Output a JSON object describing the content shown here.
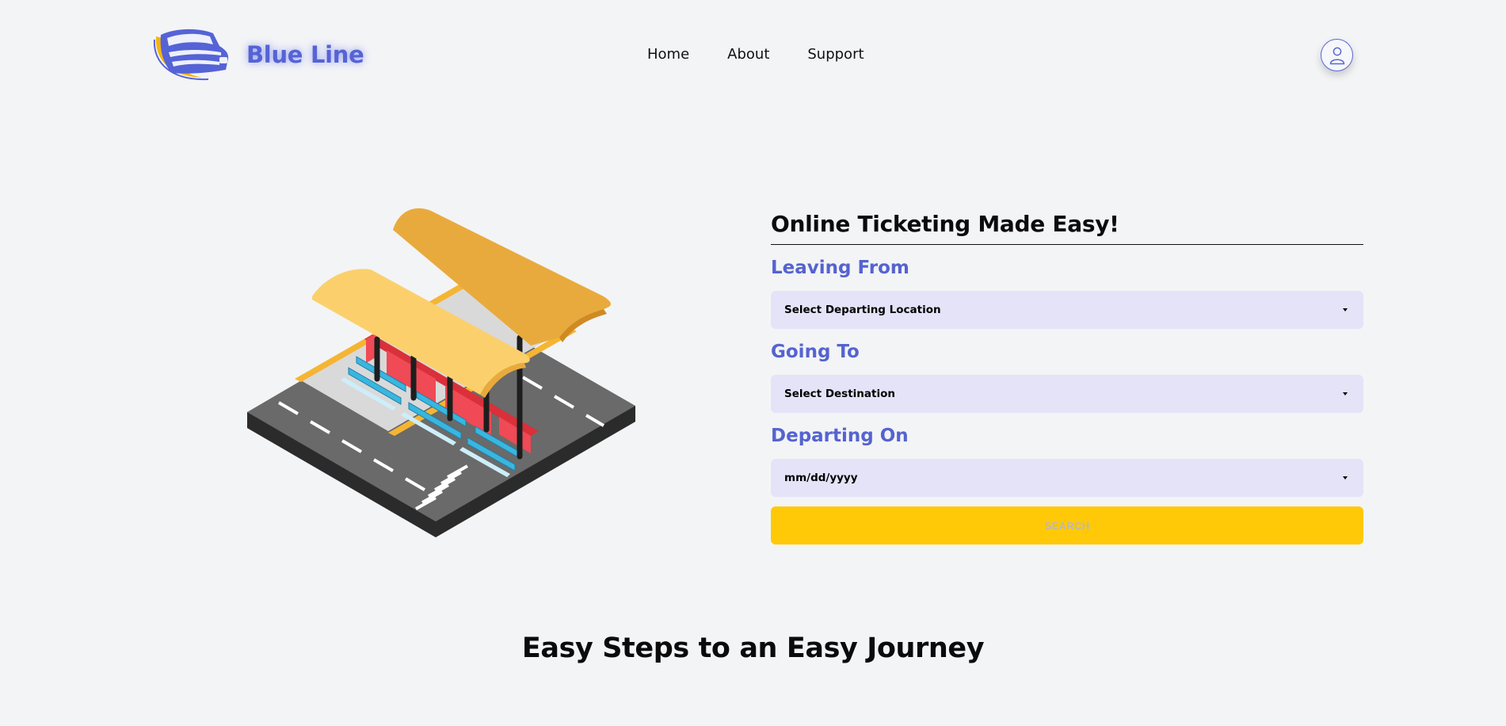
{
  "brand": {
    "name": "Blue Line",
    "logo_icon": "bus-logo-icon",
    "colors": {
      "primary": "#5563d6",
      "accent": "#f5b50f"
    }
  },
  "nav": {
    "items": [
      {
        "label": "Home"
      },
      {
        "label": "About"
      },
      {
        "label": "Support"
      }
    ]
  },
  "account": {
    "icon": "user-icon"
  },
  "hero": {
    "illustration": "bus-stop-illustration"
  },
  "booking": {
    "title": "Online Ticketing Made Easy!",
    "leaving_from": {
      "label": "Leaving From",
      "value": "Select Departing Location"
    },
    "going_to": {
      "label": "Going To",
      "value": "Select Destination"
    },
    "departing_on": {
      "label": "Departing On",
      "value": "mm/dd/yyyy"
    },
    "search_label": "SEARCH",
    "search_color": "#ffc907",
    "field_bg": "#e4e3f8"
  },
  "steps": {
    "title": "Easy Steps to an Easy Journey"
  }
}
